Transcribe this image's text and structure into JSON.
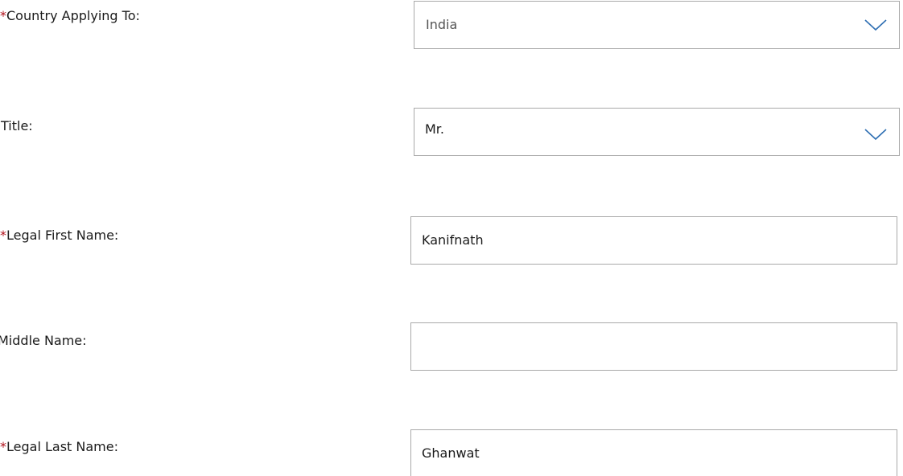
{
  "form": {
    "country": {
      "required_marker": "*",
      "label": "Country Applying To:",
      "value": "India",
      "icon": "chevron-down-icon"
    },
    "title": {
      "label": "Title:",
      "value": "Mr.",
      "icon": "chevron-down-icon"
    },
    "first_name": {
      "required_marker": "*",
      "label": "Legal First Name:",
      "value": "Kanifnath"
    },
    "middle_name": {
      "label": "Middle Name:",
      "value": ""
    },
    "last_name": {
      "required_marker": "*",
      "label": "Legal Last Name:",
      "value": "Ghanwat"
    }
  },
  "colors": {
    "required": "#b0101a",
    "chevron": "#2f6fb3",
    "border": "#a9a9a9"
  }
}
